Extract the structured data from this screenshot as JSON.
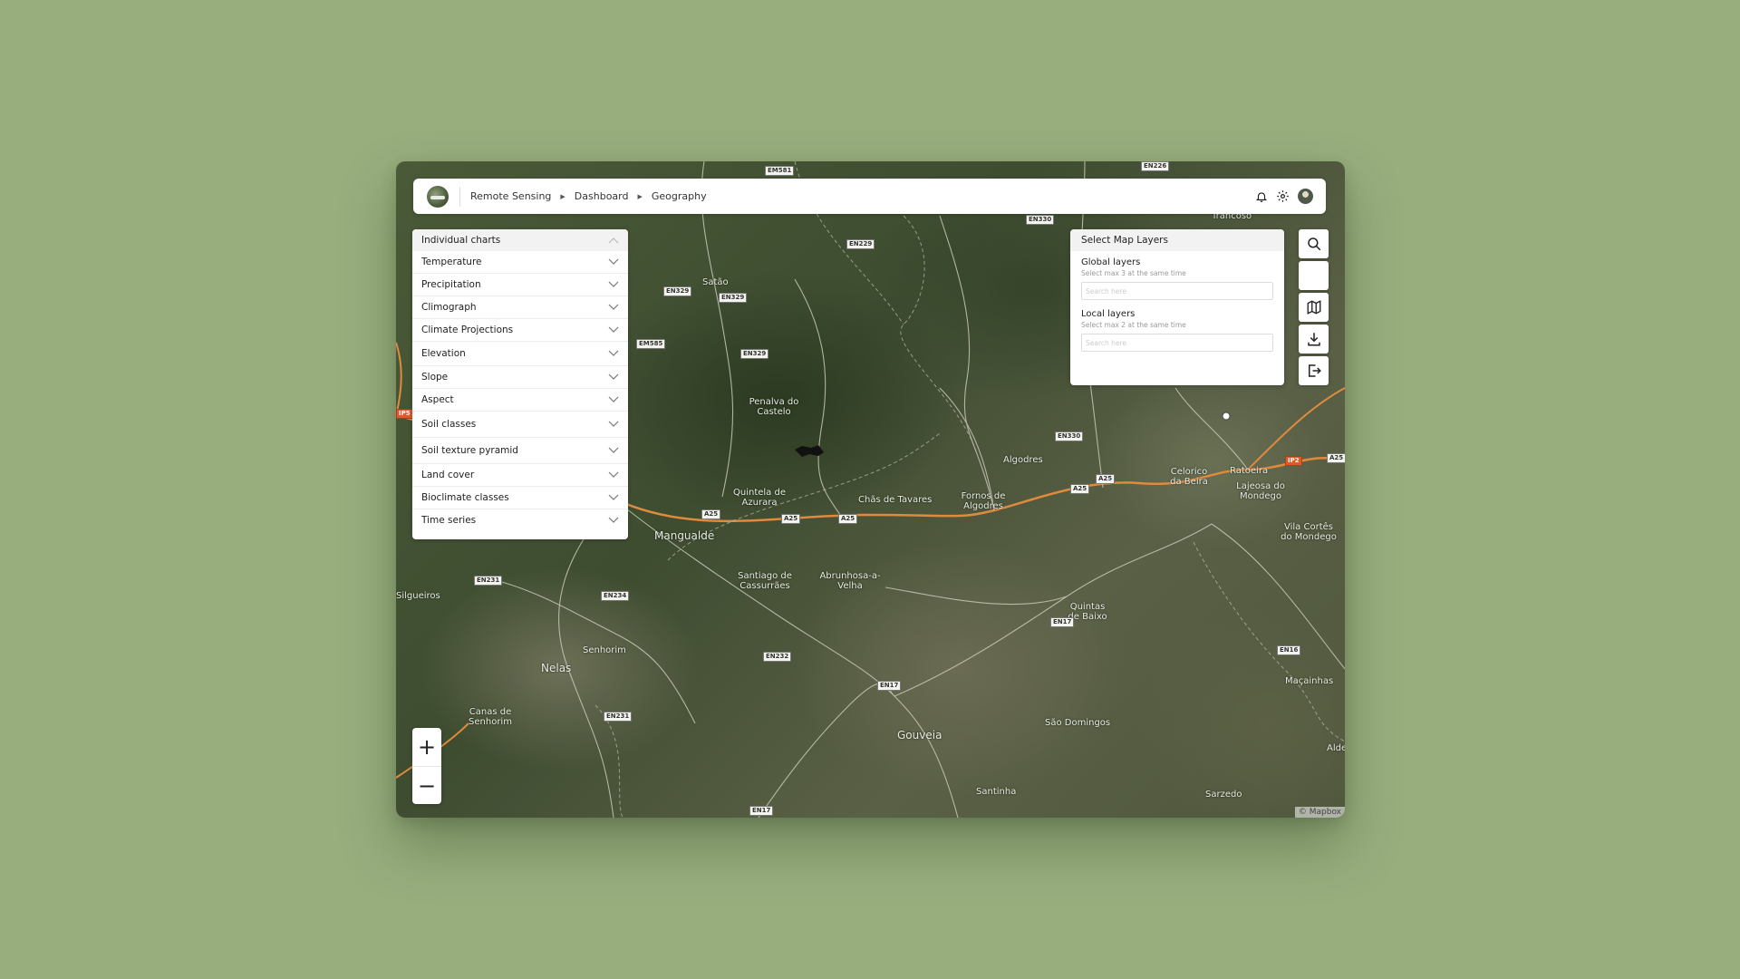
{
  "breadcrumb": {
    "items": [
      "Remote Sensing",
      "Dashboard",
      "Geography"
    ]
  },
  "charts_panel": {
    "header": "Individual charts",
    "items": [
      "Temperature",
      "Precipitation",
      "Climograph",
      "Climate Projections",
      "Elevation",
      "Slope",
      "Aspect",
      "Soil classes",
      "Soil texture pyramid",
      "Land cover",
      "Bioclimate classes",
      "Time series"
    ]
  },
  "layers_panel": {
    "title": "Select Map Layers",
    "global": {
      "label": "Global layers",
      "hint": "Select max 3 at the same time",
      "placeholder": "Search here"
    },
    "local": {
      "label": "Local layers",
      "hint": "Select max 2 at the same time",
      "placeholder": "Search here"
    }
  },
  "toolbar": {
    "icons": [
      "search-icon",
      "blank",
      "map-icon",
      "download-icon",
      "logout-icon"
    ]
  },
  "zoom": {
    "in": "+",
    "out": "−"
  },
  "map": {
    "attribution": "© Mapbox",
    "places": [
      "Trancoso",
      "Satão",
      "Penalva do Castelo",
      "Algodres",
      "Celorico da Beira",
      "Ratoeira",
      "Lajeosa do Mondego",
      "Quintela de Azurara",
      "Chãs de Tavares",
      "Fornos de Algodres",
      "Mangualde",
      "Vila Cortês do Mondego",
      "Santiago de Cassurrães",
      "Abrunhosa-a-Velha",
      "Silgueiros",
      "Quintas de Baixo",
      "Senhorim",
      "Nelas",
      "Maçainhas",
      "Canas de Senhorim",
      "Gouveia",
      "São Domingos",
      "Santinha",
      "Sarzedo",
      "Alde"
    ],
    "road_labels": [
      "EM581",
      "EN226",
      "EN330",
      "EN229",
      "EN329",
      "EN329",
      "EM585",
      "EN329",
      "EN330",
      "A25",
      "A25",
      "A25",
      "A25",
      "A25",
      "IP2",
      "IP5",
      "EN231",
      "EN234",
      "EN17",
      "EN16",
      "EN232",
      "EN17",
      "EN231",
      "EN17",
      "A25",
      "IP2"
    ]
  },
  "colors": {
    "background": "#98ae7d",
    "highway": "#d98a3c",
    "panel": "#ffffff"
  }
}
